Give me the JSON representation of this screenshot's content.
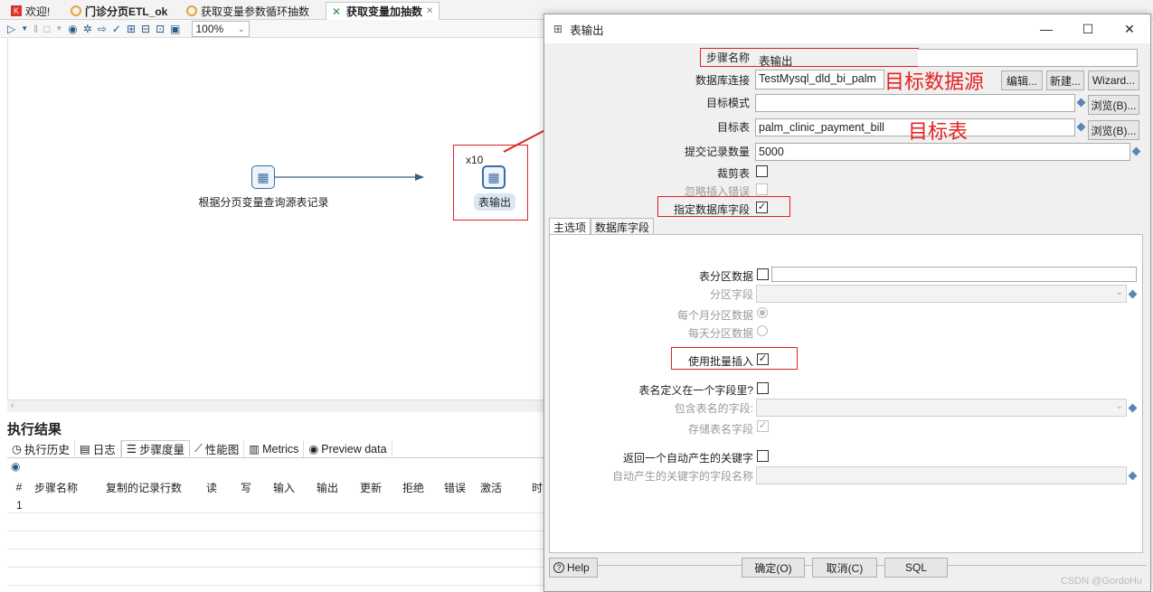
{
  "tabs": [
    {
      "label": "欢迎!",
      "icon": "kettle-logo-icon"
    },
    {
      "label": "门诊分页ETL_ok",
      "icon": "job-icon"
    },
    {
      "label": "获取变量参数循环抽数",
      "icon": "job-icon"
    },
    {
      "label": "获取变量加抽数",
      "icon": "transformation-icon",
      "active": true
    }
  ],
  "toolbar": {
    "zoom": "100%"
  },
  "canvas": {
    "step1_label": "根据分页变量查询源表记录",
    "step2_label": "表输出",
    "copies": "x10"
  },
  "results": {
    "title": "执行结果",
    "tabs": [
      "执行历史",
      "日志",
      "步骤度量",
      "性能图",
      "Metrics",
      "Preview data"
    ],
    "active_tab": "步骤度量",
    "columns": [
      "#",
      "步骤名称",
      "复制的记录行数",
      "读",
      "写",
      "输入",
      "输出",
      "更新",
      "拒绝",
      "错误",
      "激活",
      "时"
    ],
    "rows": [
      [
        "1"
      ]
    ]
  },
  "dialog": {
    "title": "表输出",
    "step_name_label": "步骤名称",
    "step_name_value": "表输出",
    "db_conn_label": "数据库连接",
    "db_conn_value": "TestMysql_dld_bi_palm",
    "edit_btn": "编辑...",
    "new_btn": "新建...",
    "wizard_btn": "Wizard...",
    "schema_label": "目标模式",
    "schema_value": "",
    "browse_btn": "浏览(B)...",
    "table_label": "目标表",
    "table_value": "palm_clinic_payment_bill",
    "commit_label": "提交记录数量",
    "commit_value": "5000",
    "truncate_label": "裁剪表",
    "ignore_errors_label": "忽略插入错误",
    "specify_fields_label": "指定数据库字段",
    "specify_fields_checked": "✓",
    "panel_tabs": [
      "主选项",
      "数据库字段"
    ],
    "partition_label": "表分区数据",
    "partition_field_label": "分区字段",
    "partition_month_label": "每个月分区数据",
    "partition_day_label": "每天分区数据",
    "batch_insert_label": "使用批量插入",
    "batch_insert_checked": "✓",
    "tablename_in_field_label": "表名定义在一个字段里?",
    "tablename_field_label": "包含表名的字段:",
    "store_tablename_label": "存储表名字段",
    "store_tablename_checked": "✓",
    "return_key_label": "返回一个自动产生的关键字",
    "return_key_field_label": "自动产生的关键字的字段名称",
    "help_btn": "Help",
    "ok_btn": "确定(O)",
    "cancel_btn": "取消(C)",
    "sql_btn": "SQL"
  },
  "annotations": {
    "target_source": "目标数据源",
    "target_table": "目标表"
  },
  "watermark": "CSDN @GordoHu",
  "colors": {
    "annotation_red": "#e52222",
    "accent_blue": "#2b5b8c"
  }
}
